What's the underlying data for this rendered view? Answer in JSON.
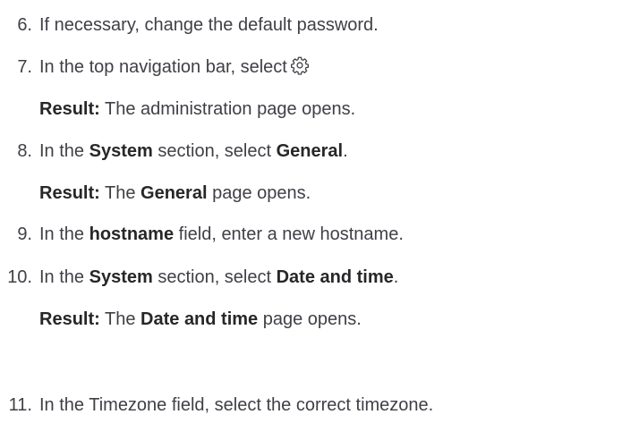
{
  "steps": [
    {
      "number": "6.",
      "text": "If necessary, change the default password."
    },
    {
      "number": "7.",
      "text_before": "In the top navigation bar, select",
      "icon": "gear-icon",
      "result_label": "Result:",
      "result_text": "The administration page opens."
    },
    {
      "number": "8.",
      "p1": "In the ",
      "b1": "System",
      "p2": " section, select ",
      "b2": "General",
      "p3": ".",
      "result_label": "Result:",
      "r1": "The ",
      "rb": "General",
      "r2": " page opens."
    },
    {
      "number": "9.",
      "p1": "In the ",
      "b1": "hostname",
      "p2": " field, enter a new hostname."
    },
    {
      "number": "10.",
      "p1": "In the ",
      "b1": "System",
      "p2": " section, select ",
      "b2": "Date and time",
      "p3": ".",
      "result_label": "Result:",
      "r1": "The ",
      "rb": "Date and time",
      "r2": " page opens."
    },
    {
      "number": "11.",
      "text": "In the Timezone field, select the correct timezone."
    }
  ]
}
